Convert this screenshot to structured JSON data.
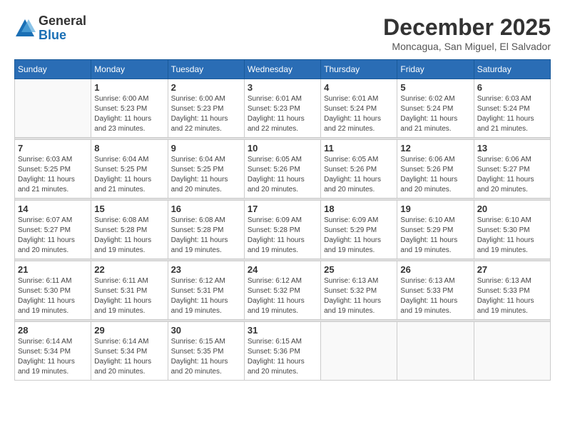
{
  "header": {
    "logo": {
      "general": "General",
      "blue": "Blue"
    },
    "title": "December 2025",
    "location": "Moncagua, San Miguel, El Salvador"
  },
  "calendar": {
    "headers": [
      "Sunday",
      "Monday",
      "Tuesday",
      "Wednesday",
      "Thursday",
      "Friday",
      "Saturday"
    ],
    "weeks": [
      [
        {
          "day": "",
          "info": ""
        },
        {
          "day": "1",
          "info": "Sunrise: 6:00 AM\nSunset: 5:23 PM\nDaylight: 11 hours\nand 23 minutes."
        },
        {
          "day": "2",
          "info": "Sunrise: 6:00 AM\nSunset: 5:23 PM\nDaylight: 11 hours\nand 22 minutes."
        },
        {
          "day": "3",
          "info": "Sunrise: 6:01 AM\nSunset: 5:23 PM\nDaylight: 11 hours\nand 22 minutes."
        },
        {
          "day": "4",
          "info": "Sunrise: 6:01 AM\nSunset: 5:24 PM\nDaylight: 11 hours\nand 22 minutes."
        },
        {
          "day": "5",
          "info": "Sunrise: 6:02 AM\nSunset: 5:24 PM\nDaylight: 11 hours\nand 21 minutes."
        },
        {
          "day": "6",
          "info": "Sunrise: 6:03 AM\nSunset: 5:24 PM\nDaylight: 11 hours\nand 21 minutes."
        }
      ],
      [
        {
          "day": "7",
          "info": "Sunrise: 6:03 AM\nSunset: 5:25 PM\nDaylight: 11 hours\nand 21 minutes."
        },
        {
          "day": "8",
          "info": "Sunrise: 6:04 AM\nSunset: 5:25 PM\nDaylight: 11 hours\nand 21 minutes."
        },
        {
          "day": "9",
          "info": "Sunrise: 6:04 AM\nSunset: 5:25 PM\nDaylight: 11 hours\nand 20 minutes."
        },
        {
          "day": "10",
          "info": "Sunrise: 6:05 AM\nSunset: 5:26 PM\nDaylight: 11 hours\nand 20 minutes."
        },
        {
          "day": "11",
          "info": "Sunrise: 6:05 AM\nSunset: 5:26 PM\nDaylight: 11 hours\nand 20 minutes."
        },
        {
          "day": "12",
          "info": "Sunrise: 6:06 AM\nSunset: 5:26 PM\nDaylight: 11 hours\nand 20 minutes."
        },
        {
          "day": "13",
          "info": "Sunrise: 6:06 AM\nSunset: 5:27 PM\nDaylight: 11 hours\nand 20 minutes."
        }
      ],
      [
        {
          "day": "14",
          "info": "Sunrise: 6:07 AM\nSunset: 5:27 PM\nDaylight: 11 hours\nand 20 minutes."
        },
        {
          "day": "15",
          "info": "Sunrise: 6:08 AM\nSunset: 5:28 PM\nDaylight: 11 hours\nand 19 minutes."
        },
        {
          "day": "16",
          "info": "Sunrise: 6:08 AM\nSunset: 5:28 PM\nDaylight: 11 hours\nand 19 minutes."
        },
        {
          "day": "17",
          "info": "Sunrise: 6:09 AM\nSunset: 5:28 PM\nDaylight: 11 hours\nand 19 minutes."
        },
        {
          "day": "18",
          "info": "Sunrise: 6:09 AM\nSunset: 5:29 PM\nDaylight: 11 hours\nand 19 minutes."
        },
        {
          "day": "19",
          "info": "Sunrise: 6:10 AM\nSunset: 5:29 PM\nDaylight: 11 hours\nand 19 minutes."
        },
        {
          "day": "20",
          "info": "Sunrise: 6:10 AM\nSunset: 5:30 PM\nDaylight: 11 hours\nand 19 minutes."
        }
      ],
      [
        {
          "day": "21",
          "info": "Sunrise: 6:11 AM\nSunset: 5:30 PM\nDaylight: 11 hours\nand 19 minutes."
        },
        {
          "day": "22",
          "info": "Sunrise: 6:11 AM\nSunset: 5:31 PM\nDaylight: 11 hours\nand 19 minutes."
        },
        {
          "day": "23",
          "info": "Sunrise: 6:12 AM\nSunset: 5:31 PM\nDaylight: 11 hours\nand 19 minutes."
        },
        {
          "day": "24",
          "info": "Sunrise: 6:12 AM\nSunset: 5:32 PM\nDaylight: 11 hours\nand 19 minutes."
        },
        {
          "day": "25",
          "info": "Sunrise: 6:13 AM\nSunset: 5:32 PM\nDaylight: 11 hours\nand 19 minutes."
        },
        {
          "day": "26",
          "info": "Sunrise: 6:13 AM\nSunset: 5:33 PM\nDaylight: 11 hours\nand 19 minutes."
        },
        {
          "day": "27",
          "info": "Sunrise: 6:13 AM\nSunset: 5:33 PM\nDaylight: 11 hours\nand 19 minutes."
        }
      ],
      [
        {
          "day": "28",
          "info": "Sunrise: 6:14 AM\nSunset: 5:34 PM\nDaylight: 11 hours\nand 19 minutes."
        },
        {
          "day": "29",
          "info": "Sunrise: 6:14 AM\nSunset: 5:34 PM\nDaylight: 11 hours\nand 20 minutes."
        },
        {
          "day": "30",
          "info": "Sunrise: 6:15 AM\nSunset: 5:35 PM\nDaylight: 11 hours\nand 20 minutes."
        },
        {
          "day": "31",
          "info": "Sunrise: 6:15 AM\nSunset: 5:36 PM\nDaylight: 11 hours\nand 20 minutes."
        },
        {
          "day": "",
          "info": ""
        },
        {
          "day": "",
          "info": ""
        },
        {
          "day": "",
          "info": ""
        }
      ]
    ]
  }
}
